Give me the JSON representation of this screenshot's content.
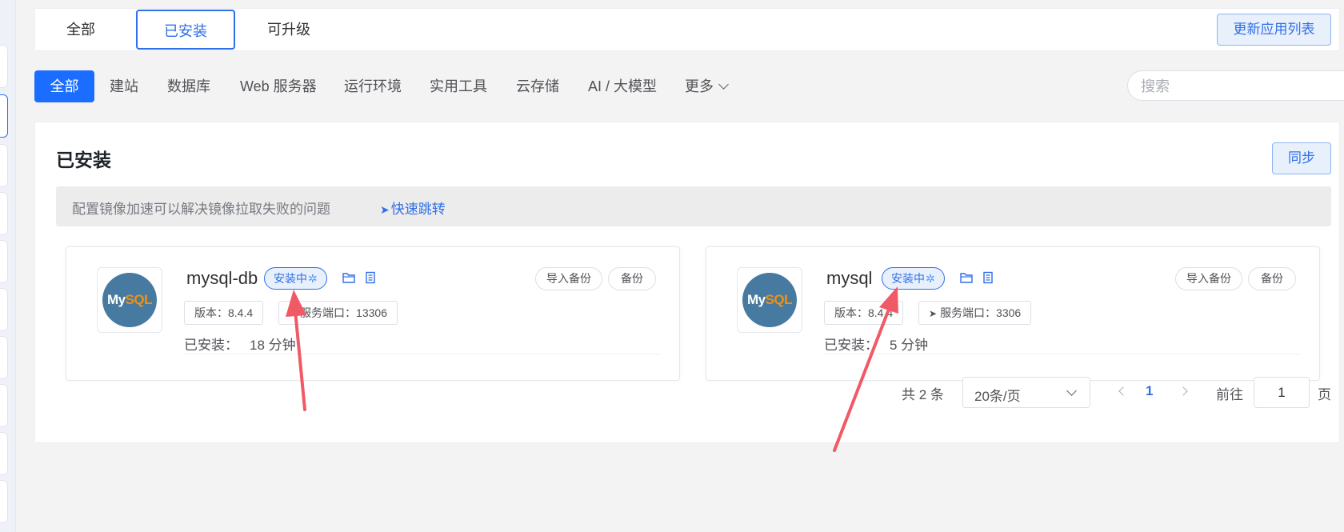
{
  "top_tabs": [
    {
      "label": "全部"
    },
    {
      "label": "已安装"
    },
    {
      "label": "可升级"
    }
  ],
  "update_list_button": "更新应用列表",
  "categories": [
    {
      "label": "全部"
    },
    {
      "label": "建站"
    },
    {
      "label": "数据库"
    },
    {
      "label": "Web 服务器"
    },
    {
      "label": "运行环境"
    },
    {
      "label": "实用工具"
    },
    {
      "label": "云存储"
    },
    {
      "label": "AI / 大模型"
    },
    {
      "label": "更多"
    }
  ],
  "search": {
    "placeholder": "搜索",
    "value": ""
  },
  "panel": {
    "title": "已安装",
    "sync_button": "同步",
    "notice_text": "配置镜像加速可以解决镜像拉取失败的问题",
    "notice_link": "快速跳转"
  },
  "apps": [
    {
      "name": "mysql-db",
      "status": "安装中",
      "import_backup": "导入备份",
      "backup": "备份",
      "version": "版本：8.4.4",
      "port": "服务端口：13306",
      "installed_label": "已安装：",
      "installed_time": "18 分钟"
    },
    {
      "name": "mysql",
      "status": "安装中",
      "import_backup": "导入备份",
      "backup": "备份",
      "version": "版本：8.4.4",
      "port": "服务端口：3306",
      "installed_label": "已安装：",
      "installed_time": "5 分钟"
    }
  ],
  "logo": {
    "text_my": "My",
    "text_sql": "SQL"
  },
  "pagination": {
    "total": "共 2 条",
    "page_size": "20条/页",
    "current_page": "1",
    "goto_label": "前往",
    "goto_value": "1",
    "page_unit": "页"
  },
  "icons": {
    "search": "search-icon",
    "folder": "folder-icon",
    "doc": "document-icon",
    "navigate": "navigation-arrow-icon",
    "spinner": "loading-spinner-icon"
  },
  "colors": {
    "primary": "#2f6fe8",
    "active_category_bg": "#1a6dff",
    "mysql_logo": "#477aa0",
    "annotation_arrow": "#f05a67"
  }
}
